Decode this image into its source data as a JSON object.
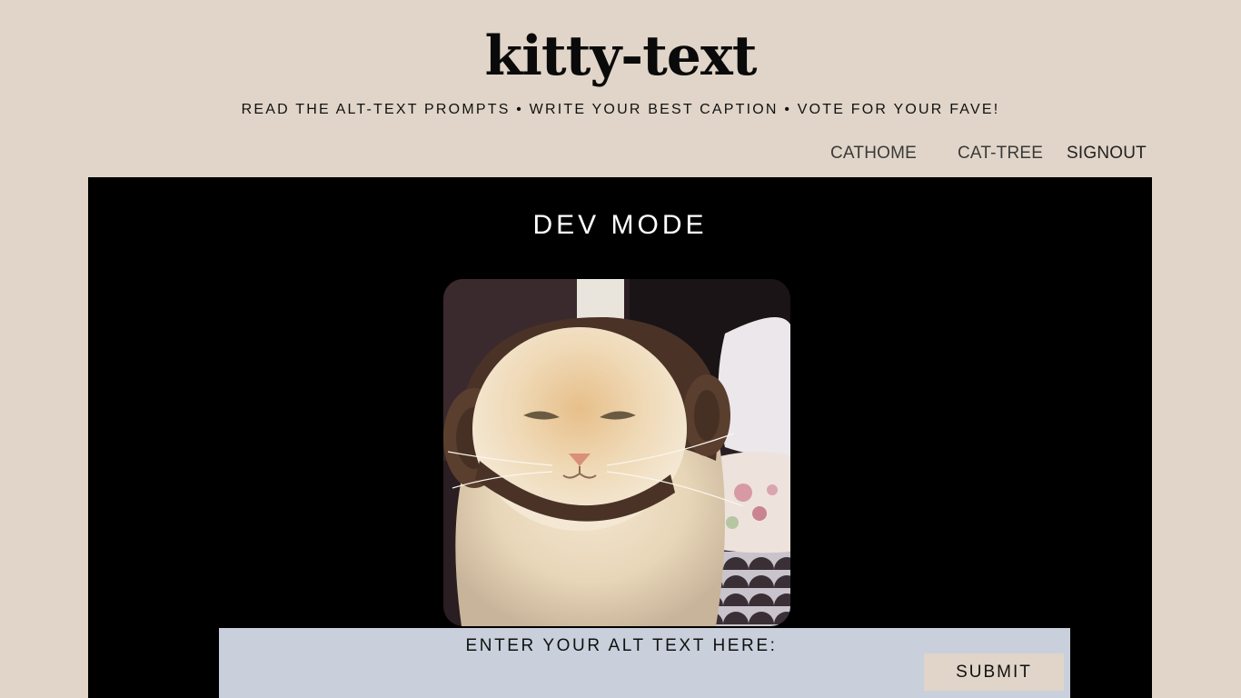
{
  "header": {
    "title": "kitty-text",
    "tagline": "READ THE ALT-TEXT PROMPTS • WRITE YOUR BEST CAPTION • VOTE FOR YOUR FAVE!"
  },
  "nav": {
    "items": [
      {
        "label": "CATHOME"
      },
      {
        "label": "CAT-TREE"
      },
      {
        "label": "SIGNOUT"
      }
    ]
  },
  "main": {
    "heading": "DEV MODE",
    "form": {
      "label": "ENTER YOUR ALT TEXT HERE:",
      "input_value": "",
      "submit_label": "SUBMIT"
    }
  },
  "colors": {
    "page_background": "#e0d5c8",
    "panel_background": "#000000",
    "form_background": "#c9d0db",
    "button_background": "#e0d5c8"
  }
}
